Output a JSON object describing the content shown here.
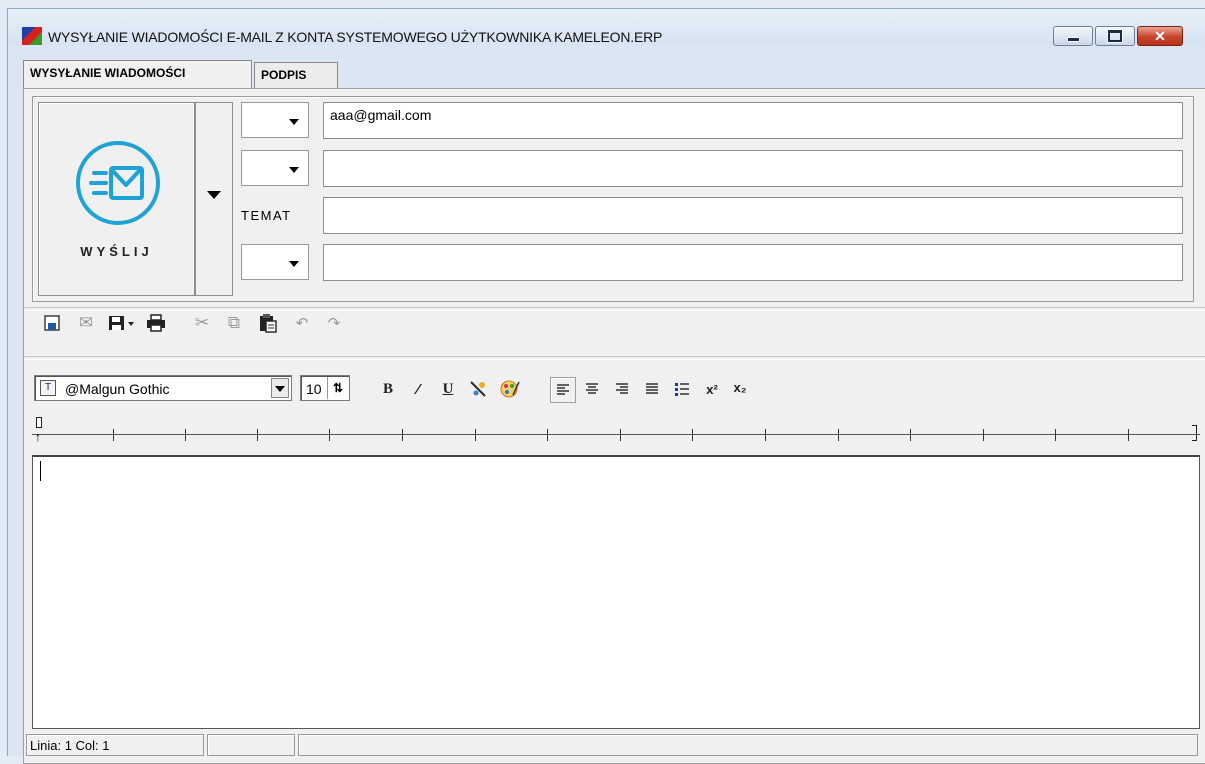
{
  "window": {
    "title": "WYSYŁANIE WIADOMOŚCI E-MAIL Z KONTA SYSTEMOWEGO UŻYTKOWNIKA KAMELEON.ERP",
    "app_icon": "kameleon-app-icon",
    "controls": {
      "minimize": "minimize-icon",
      "maximize": "maximize-icon",
      "close": "close-icon"
    }
  },
  "tabs": [
    {
      "label": "WYSYŁANIE WIADOMOŚCI",
      "active": true
    },
    {
      "label": "PODPIS",
      "active": false
    }
  ],
  "compose": {
    "send_label": "WYŚLIJ",
    "send_icon": "send-mail-icon",
    "subject_label": "TEMAT",
    "fields": [
      {
        "value": "aaa@gmail.com",
        "has_dropdown": true
      },
      {
        "value": "",
        "has_dropdown": true
      },
      {
        "value": "",
        "has_dropdown": false
      },
      {
        "value": "",
        "has_dropdown": true
      }
    ]
  },
  "toolbar": {
    "icons": [
      "new-document-icon",
      "attach-icon",
      "save-icon",
      "print-icon",
      "cut-icon",
      "copy-icon",
      "paste-icon",
      "undo-icon",
      "redo-icon"
    ]
  },
  "format_bar": {
    "font": "@Malgun Gothic",
    "size": "10",
    "icons": [
      "bold-icon",
      "italic-icon",
      "underline-icon",
      "text-color-icon",
      "highlight-color-icon",
      "align-left-icon",
      "align-center-icon",
      "align-right-icon",
      "align-justify-icon",
      "bullet-list-icon",
      "superscript-icon",
      "subscript-icon"
    ]
  },
  "editor": {
    "content": ""
  },
  "status": {
    "position": "Linia:  1  Col:  1",
    "cell2": "",
    "cell3": ""
  },
  "colors": {
    "accent": "#1fa3d6",
    "close_button": "#c8452d"
  }
}
